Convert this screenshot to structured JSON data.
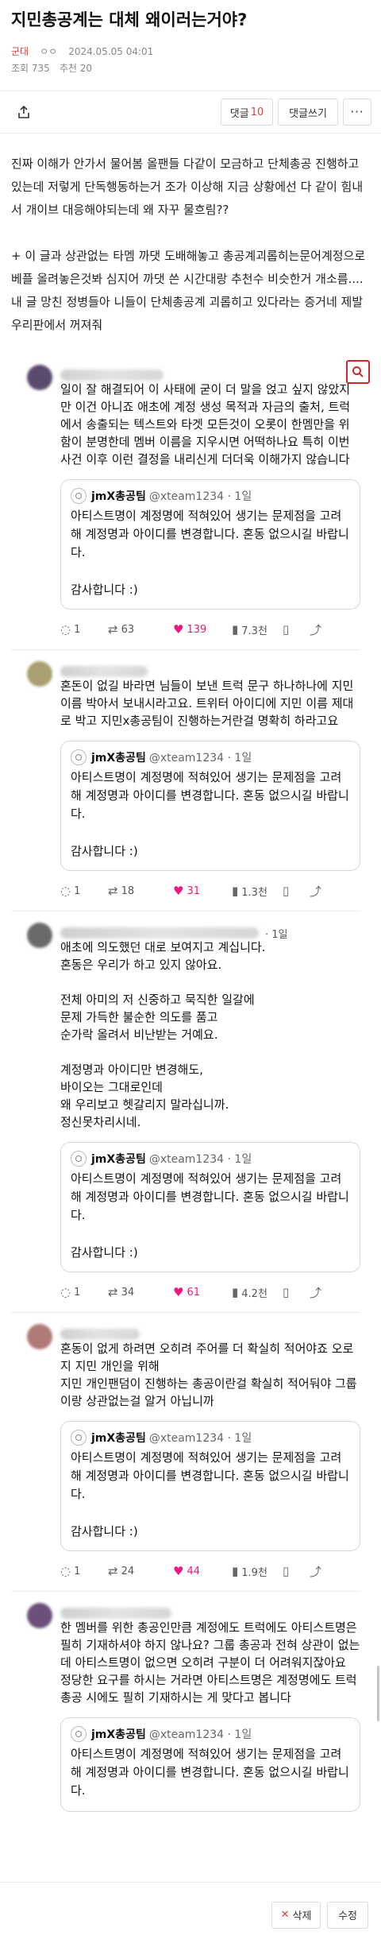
{
  "post": {
    "title": "지민총공계는 대체 왜이러는거야?",
    "board": "군대",
    "rating_icon": "ㅇㅇ",
    "datetime": "2024.05.05 04:01",
    "views": "조회 735",
    "recommend": "추천 20"
  },
  "actionbar": {
    "share_icon": "share-icon",
    "comment_label": "댓글",
    "comment_count": "10",
    "write_label": "댓글쓰기",
    "more_label": "···"
  },
  "body": {
    "p1": "진짜 이해가 안가서 물어봄 올팬들 다같이 모금하고 단체총공 진행하고 있는데 저렇게 단독행동하는거 조가 이상해 지금 상황에선 다 같이 힘내서 개이브 대응해야되는데 왜 자꾸 물흐림??",
    "p2": "+ 이 글과 상관없는 타멤 까댓 도배해놓고 총공계괴롭히는문어계정으로 베플 올려놓은것봐 심지어 까댓 쓴 시간대랑 추천수 비슷한거 개소름.... 내 글 망친 정병들아 니들이 단체총공계 괴롭히고 있다라는 증거네 제발 우리판에서 꺼져줘"
  },
  "search_icon": "search-icon",
  "quote": {
    "name": "jmX총공팀",
    "handle": "@xteam1234 · 1일",
    "text": "아티스트명이 계정명에 적혀있어 생기는 문제점을 고려해 계정명과 아이디를 변경합니다. 혼동 없으시길 바랍니다.",
    "thanks": "감사합니다 :)"
  },
  "tweets": [
    {
      "time": "",
      "text": "일이 잘 해결되어 이 사태에 굳이 더 말을 얹고 싶지 않았지만 이건 아니죠 애초에 계정 생성 목적과 자금의 출처, 트럭에서 송출되는 텍스트와 타겟 모든것이 오롯이 한멤만을 위함이 분명한데 멤버 이름을 지우시면 어떡하나요 특히 이번 사건 이후 이런 결정을 내리신게 더더욱 이해가지 않습니다",
      "replies": "1",
      "retweets": "63",
      "likes": "139",
      "views": "7.3천"
    },
    {
      "time": "",
      "text": "혼돈이 없길 바라면 님들이 보낸 트럭 문구 하나하나에 지민 이름 박아서 보내시라고요. 트위터 아이디에 지민 이름 제대로 박고 지민x총공팀이 진행하는거란걸 명확히 하라고요",
      "replies": "1",
      "retweets": "18",
      "likes": "31",
      "views": "1.3천"
    },
    {
      "time": "· 1일",
      "text": "애초에 의도했던 대로 보여지고 계십니다.\n혼동은 우리가 하고 있지 않아요.\n\n전체 아미의 저 신중하고 묵직한 일갈에\n문제 가득한 불순한 의도를 품고\n순가락 올려서 비난받는 거예요.\n\n계정명과 아이디만 변경해도,\n바이오는 그대로인데\n왜 우리보고 헷갈리지 말라십니까.\n정신못차리시네.",
      "replies": "1",
      "retweets": "34",
      "likes": "61",
      "views": "4.2천"
    },
    {
      "time": "",
      "text": "혼동이 없게 하려면 오히려 주어를 더 확실히 적어야죠 오로지 지민 개인을 위해\n지민 개인팬덤이 진행하는 총공이란걸 확실히 적어둬야 그룹이랑 상관없는걸 알거 아닙니까",
      "replies": "1",
      "retweets": "24",
      "likes": "44",
      "views": "1.9천"
    },
    {
      "time": "",
      "text": "한 멤버를 위한 총공인만큼 계정에도 트럭에도 아티스트명은 필히 기재하셔야 하지 않나요? 그룹 총공과 전혀 상관이 없는데 아티스트명이 없으면 오히려 구분이 더 어려워지잖아요 정당한 요구를 하시는 거라면 아티스트명은 계정명에도 트럭총공 시에도 필히 기재하시는 게 맞다고 봅니다",
      "replies": "",
      "retweets": "",
      "likes": "",
      "views": ""
    }
  ],
  "avatar_colors": [
    "#5a4a6e",
    "#a8a070",
    "#6a6a6a",
    "#b07a78",
    "#6c4f7a"
  ],
  "name_blur_widths": [
    130,
    110,
    250,
    100,
    140
  ],
  "footer": {
    "delete_icon": "close-icon",
    "delete_label": "삭제",
    "edit_label": "수정"
  }
}
